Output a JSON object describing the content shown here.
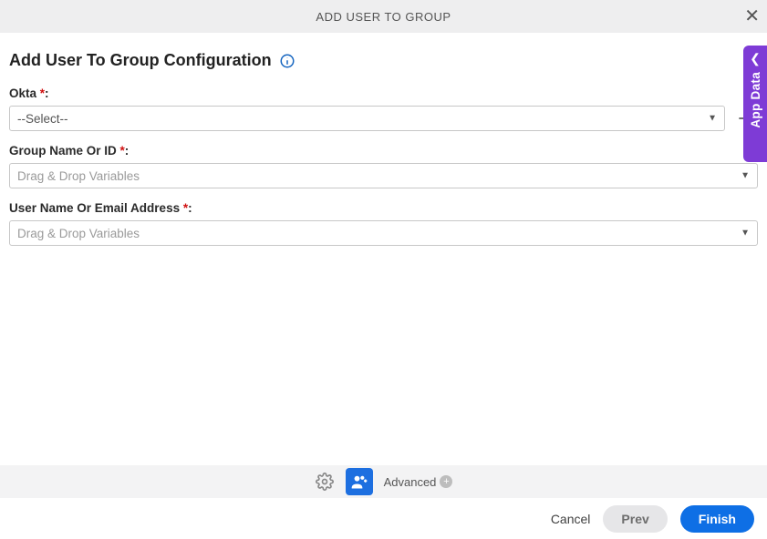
{
  "header": {
    "title": "ADD USER TO GROUP"
  },
  "section": {
    "title": "Add User To Group Configuration"
  },
  "form": {
    "okta": {
      "label": "Okta ",
      "value": "--Select--"
    },
    "group": {
      "label": "Group Name Or ID ",
      "placeholder": "Drag & Drop Variables"
    },
    "user": {
      "label": "User Name Or Email Address ",
      "placeholder": "Drag & Drop Variables"
    }
  },
  "toolbar": {
    "advanced": "Advanced"
  },
  "footer": {
    "cancel": "Cancel",
    "prev": "Prev",
    "finish": "Finish"
  },
  "side": {
    "label": "App Data"
  },
  "labels": {
    "colon": ":",
    "star": "*"
  }
}
